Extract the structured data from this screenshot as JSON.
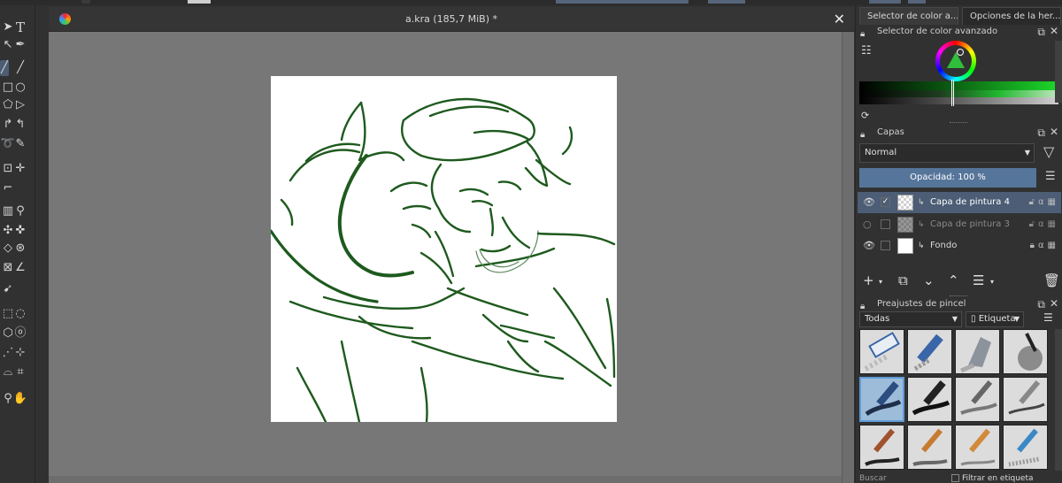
{
  "window": {
    "document_title": "a.kra (185,7 MiB) *"
  },
  "colors": {
    "accent": "#4c5d75",
    "line_art": "#1e5a1e",
    "canvas_bg": "#777777"
  },
  "toolbox": {
    "icons": [
      "select-shapes-icon",
      "text-icon",
      "edit-shapes-icon",
      "calligraphy-icon",
      "freehand-brush-icon",
      "line-icon",
      "rectangle-icon",
      "ellipse-icon",
      "polygon-icon",
      "polyline-icon",
      "bezier-icon",
      "freehand-path-icon",
      "dynamic-brush-icon",
      "multibrush-icon",
      "transform-icon",
      "move-icon",
      "crop-icon",
      "gradient-icon",
      "color-picker-icon",
      "smart-patch-icon",
      "fill-icon",
      "enclose-fill-icon",
      "assistant-icon",
      "measure-icon",
      "reference-icon",
      "rect-select-icon",
      "ellipse-select-icon",
      "polygon-select-icon",
      "freehand-select-icon",
      "contiguous-select-icon",
      "similar-select-icon",
      "bezier-select-icon",
      "magnetic-select-icon",
      "zoom-icon",
      "pan-icon"
    ]
  },
  "dock": {
    "tabs": [
      "Selector de color a...",
      "Opciones de la her..."
    ],
    "color_panel": {
      "title": "Selector de color avanzado"
    },
    "layers_panel": {
      "title": "Capas",
      "blend_mode": "Normal",
      "opacity_label": "Opacidad:",
      "opacity_value": "100 %",
      "layers": [
        {
          "name": "Capa de pintura 4",
          "visible": true,
          "selected": true
        },
        {
          "name": "Capa de pintura 3",
          "visible": false,
          "selected": false
        },
        {
          "name": "Fondo",
          "visible": true,
          "selected": false
        }
      ]
    },
    "brush_panel": {
      "title": "Preajustes de pincel",
      "filter": "Todas",
      "tag_label": "Etiqueta",
      "search_placeholder": "Buscar",
      "filter_tag_label": "Filtrar en etiqueta",
      "presets": [
        "eraser",
        "marker-blue",
        "eraser-gray",
        "airbrush",
        "pen-ink",
        "ink-black",
        "pencil-soft",
        "pencil-hard",
        "brush-round",
        "brush-flat",
        "brush-wet",
        "pencil-blue"
      ]
    }
  }
}
